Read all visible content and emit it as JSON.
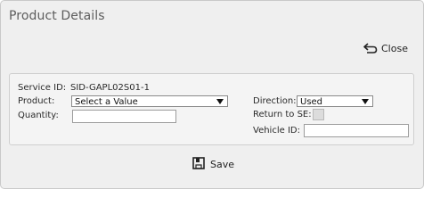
{
  "dialog": {
    "title": "Product Details"
  },
  "toolbar": {
    "close_label": "Close",
    "close_icon": "undo-arrow-icon"
  },
  "form": {
    "service_id_label": "Service ID:",
    "service_id_value": "SID-GAPL02S01-1",
    "product_label": "Product:",
    "product_selected": "Select a Value",
    "quantity_label": "Quantity:",
    "quantity_value": "",
    "direction_label": "Direction:",
    "direction_selected": "Used",
    "return_label": "Return to SE:",
    "return_checked": false,
    "vehicle_label": "Vehicle ID:",
    "vehicle_value": ""
  },
  "footer": {
    "save_label": "Save",
    "save_icon": "save-disk-icon"
  }
}
